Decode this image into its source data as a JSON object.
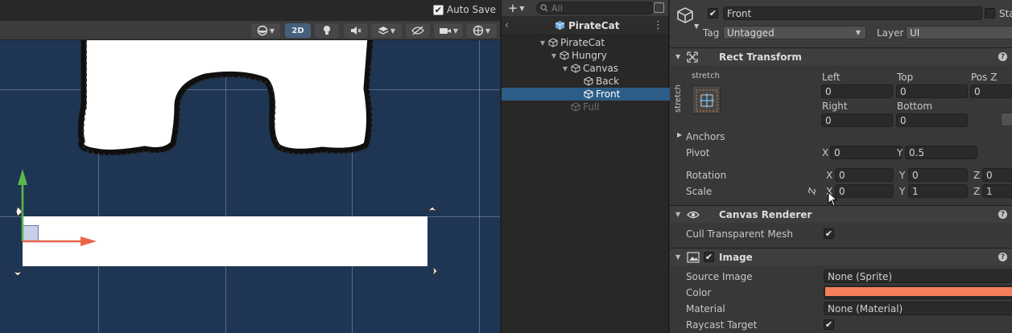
{
  "scene_view": {
    "auto_save": {
      "label": "Auto Save",
      "checked": true
    },
    "toolbar": {
      "mode_2d": "2D"
    },
    "colors": {
      "background": "#1e3553",
      "canvas_fill": "#ffffff",
      "x_axis": "#e8654a",
      "y_axis": "#5ab84a"
    }
  },
  "hierarchy": {
    "add_label": "+",
    "search_placeholder": "All",
    "scene_name": "PirateCat",
    "items": [
      {
        "label": "PirateCat",
        "depth": 0,
        "expanded": true
      },
      {
        "label": "Hungry",
        "depth": 1,
        "expanded": true
      },
      {
        "label": "Canvas",
        "depth": 2,
        "expanded": true
      },
      {
        "label": "Back",
        "depth": 3
      },
      {
        "label": "Front",
        "depth": 3,
        "selected": true
      },
      {
        "label": "Full",
        "depth": 2,
        "inactive": true
      }
    ]
  },
  "inspector": {
    "object_name": "Front",
    "active": true,
    "static_label": "Sta",
    "tag_label": "Tag",
    "tag_value": "Untagged",
    "layer_label": "Layer",
    "layer_value": "UI",
    "rect_transform": {
      "title": "Rect Transform",
      "anchor_preset_h": "stretch",
      "anchor_preset_v": "stretch",
      "left_label": "Left",
      "left": "0",
      "top_label": "Top",
      "top": "0",
      "posz_label": "Pos Z",
      "posz": "0",
      "right_label": "Right",
      "right": "0",
      "bottom_label": "Bottom",
      "bottom": "0",
      "anchors_label": "Anchors",
      "pivot_label": "Pivot",
      "pivot_x": "0",
      "pivot_y": "0.5",
      "rotation_label": "Rotation",
      "rot_x": "0",
      "rot_y": "0",
      "rot_z": "0",
      "scale_label": "Scale",
      "scale_x": "0",
      "scale_y": "1",
      "scale_z": "1",
      "axis_x": "X",
      "axis_y": "Y",
      "axis_z": "Z"
    },
    "canvas_renderer": {
      "title": "Canvas Renderer",
      "cull_label": "Cull Transparent Mesh",
      "cull_checked": true
    },
    "image": {
      "title": "Image",
      "enabled": true,
      "source_label": "Source Image",
      "source_value": "None (Sprite)",
      "color_label": "Color",
      "color_value": "#f47f5b",
      "material_label": "Material",
      "material_value": "None (Material)",
      "raycast_label": "Raycast Target",
      "raycast_checked": true
    }
  }
}
